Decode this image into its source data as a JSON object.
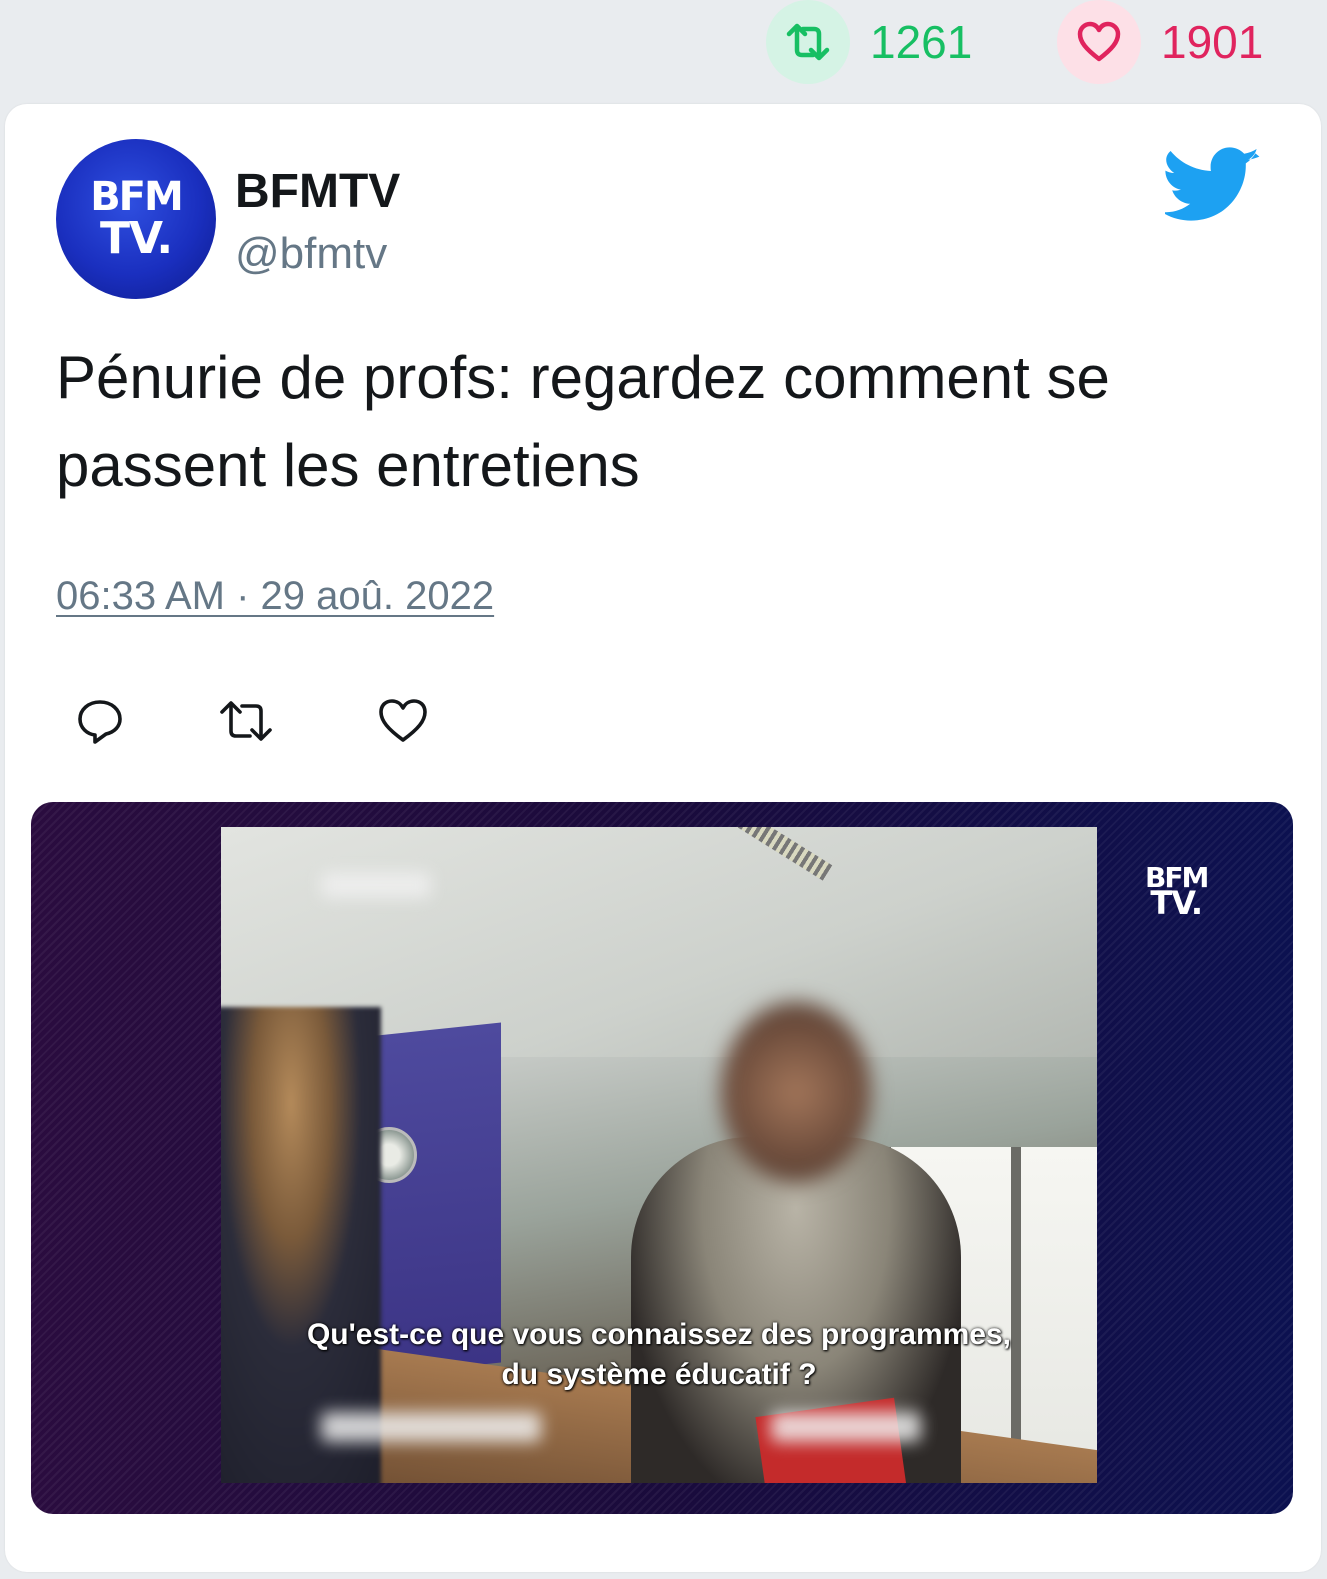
{
  "stats": {
    "retweets": "1261",
    "likes": "1901",
    "retweet_color": "#17bf63",
    "like_color": "#e0245e"
  },
  "tweet": {
    "author_name": "BFMTV",
    "author_handle": "@bfmtv",
    "avatar_logo": {
      "line1": "BFM",
      "line2": "TV."
    },
    "text": "Pénurie de profs: regardez comment se passent les entretiens",
    "timestamp": "06:33 AM · 29 aoû. 2022",
    "platform_icon": "twitter-bird-icon",
    "brand_color": "#1da1f2",
    "actions": [
      "reply-icon",
      "retweet-icon",
      "like-icon"
    ]
  },
  "media": {
    "subtitle_line1": "Qu'est-ce que vous connaissez des programmes,",
    "subtitle_line2": "du système éducatif ?",
    "channel_logo": {
      "line1": "BFM",
      "line2": "TV."
    }
  }
}
